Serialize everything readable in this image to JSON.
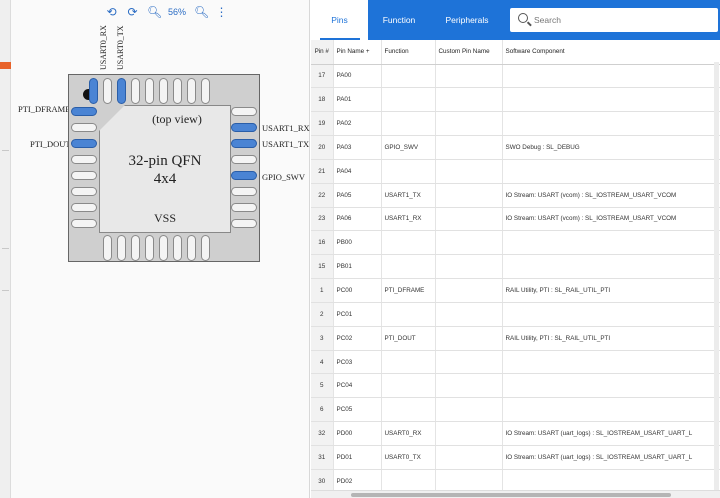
{
  "toolbar": {
    "zoom_level": "56%",
    "icons": [
      "rotate-left-icon",
      "rotate-right-icon",
      "zoom-out-icon",
      "zoom-in-icon",
      "more-vertical-icon"
    ]
  },
  "chip": {
    "view_label": "(top view)",
    "name": "32-pin QFN",
    "size": "4x4",
    "vss_label": "VSS"
  },
  "signal_labels": {
    "left": [
      "PTI_DFRAME",
      "PTI_DOUT"
    ],
    "right": [
      "USART1_RX",
      "USART1_TX",
      "GPIO_SWV"
    ],
    "top": [
      "USART0_RX",
      "USART0_TX"
    ]
  },
  "tabs": [
    {
      "label": "Pins",
      "active": true
    },
    {
      "label": "Function",
      "active": false
    },
    {
      "label": "Peripherals",
      "active": false
    }
  ],
  "search": {
    "placeholder": "Search",
    "value": ""
  },
  "table": {
    "columns": [
      "Pin #",
      "Pin Name +",
      "Function",
      "Custom Pin Name",
      "Software Component"
    ],
    "rows": [
      {
        "pin": "17",
        "name": "PA00",
        "function": "",
        "custom": "",
        "component": ""
      },
      {
        "pin": "18",
        "name": "PA01",
        "function": "",
        "custom": "",
        "component": ""
      },
      {
        "pin": "19",
        "name": "PA02",
        "function": "",
        "custom": "",
        "component": ""
      },
      {
        "pin": "20",
        "name": "PA03",
        "function": "GPIO_SWV",
        "custom": "",
        "component": "SWO Debug : SL_DEBUG"
      },
      {
        "pin": "21",
        "name": "PA04",
        "function": "",
        "custom": "",
        "component": ""
      },
      {
        "pin": "22",
        "name": "PA05",
        "function": "USART1_TX",
        "custom": "",
        "component": "IO Stream: USART (vcom) : SL_IOSTREAM_USART_VCOM"
      },
      {
        "pin": "23",
        "name": "PA06",
        "function": "USART1_RX",
        "custom": "",
        "component": "IO Stream: USART (vcom) : SL_IOSTREAM_USART_VCOM"
      },
      {
        "pin": "16",
        "name": "PB00",
        "function": "",
        "custom": "",
        "component": ""
      },
      {
        "pin": "15",
        "name": "PB01",
        "function": "",
        "custom": "",
        "component": ""
      },
      {
        "pin": "1",
        "name": "PC00",
        "function": "PTI_DFRAME",
        "custom": "",
        "component": "RAIL Utility, PTI : SL_RAIL_UTIL_PTI"
      },
      {
        "pin": "2",
        "name": "PC01",
        "function": "",
        "custom": "",
        "component": ""
      },
      {
        "pin": "3",
        "name": "PC02",
        "function": "PTI_DOUT",
        "custom": "",
        "component": "RAIL Utility, PTI : SL_RAIL_UTIL_PTI"
      },
      {
        "pin": "4",
        "name": "PC03",
        "function": "",
        "custom": "",
        "component": ""
      },
      {
        "pin": "5",
        "name": "PC04",
        "function": "",
        "custom": "",
        "component": ""
      },
      {
        "pin": "6",
        "name": "PC05",
        "function": "",
        "custom": "",
        "component": ""
      },
      {
        "pin": "32",
        "name": "PD00",
        "function": "USART0_RX",
        "custom": "",
        "component": "IO Stream: USART (uart_logs) : SL_IOSTREAM_USART_UART_L"
      },
      {
        "pin": "31",
        "name": "PD01",
        "function": "USART0_TX",
        "custom": "",
        "component": "IO Stream: USART (uart_logs) : SL_IOSTREAM_USART_UART_L"
      },
      {
        "pin": "30",
        "name": "PD02",
        "function": "",
        "custom": "",
        "component": ""
      }
    ]
  },
  "colors": {
    "accent": "#1e73d8",
    "pin_active": "#4a84d4",
    "left_marker": "#e8622a"
  }
}
